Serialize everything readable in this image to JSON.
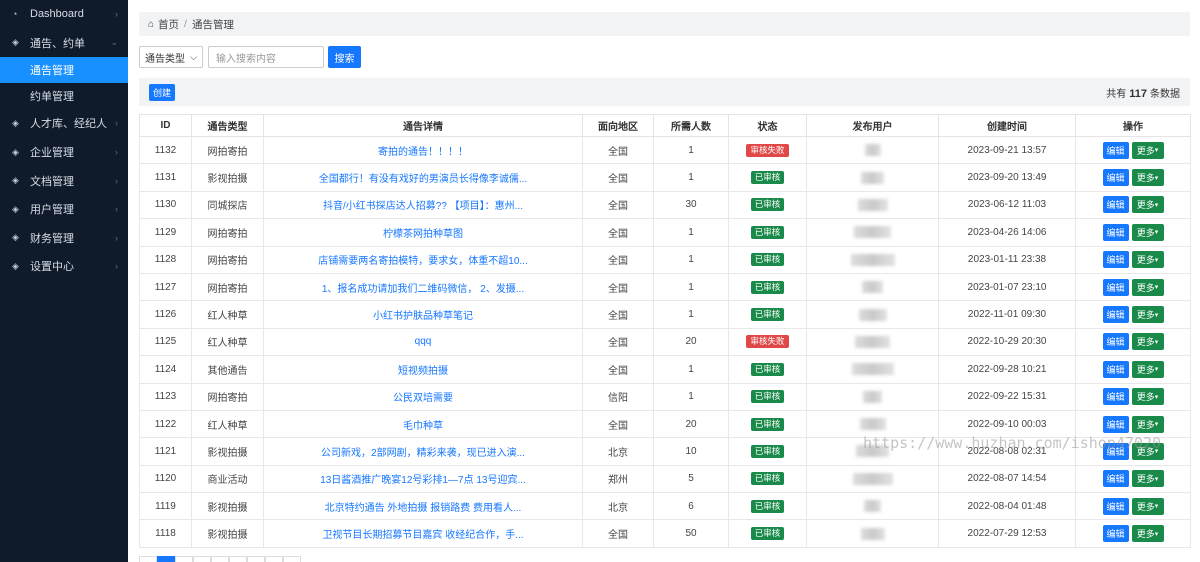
{
  "sidebar": {
    "items": [
      {
        "label": "Dashboard",
        "icon": "dashboard-icon"
      },
      {
        "label": "通告、约单",
        "icon": "chevron-icon",
        "expanded": true,
        "children": [
          {
            "label": "通告管理",
            "active": true
          },
          {
            "label": "约单管理",
            "active": false
          }
        ]
      },
      {
        "label": "人才库、经纪人",
        "icon": "chevron-icon"
      },
      {
        "label": "企业管理",
        "icon": "chevron-icon"
      },
      {
        "label": "文档管理",
        "icon": "chevron-icon"
      },
      {
        "label": "用户管理",
        "icon": "chevron-icon"
      },
      {
        "label": "财务管理",
        "icon": "chevron-icon"
      },
      {
        "label": "设置中心",
        "icon": "chevron-icon"
      }
    ]
  },
  "breadcrumb": {
    "home": "首页",
    "current": "通告管理"
  },
  "search": {
    "type_select": "通告类型",
    "placeholder": "输入搜索内容",
    "button": "搜索"
  },
  "toolbar": {
    "create": "创建",
    "total_prefix": "共有",
    "total_count": "117",
    "total_suffix": "条数据"
  },
  "table": {
    "headers": [
      "ID",
      "通告类型",
      "通告详情",
      "面向地区",
      "所需人数",
      "状态",
      "发布用户",
      "创建时间",
      "操作"
    ],
    "edit_label": "编辑",
    "more_label": "更多",
    "rows": [
      {
        "id": "1132",
        "type": "网拍寄拍",
        "detail": "寄拍的通告！！！！",
        "region": "全国",
        "count": "1",
        "status": "审核失败",
        "status_kind": "fail",
        "created": "2023-09-21 13:57"
      },
      {
        "id": "1131",
        "type": "影视拍摄",
        "detail": "全国都行！有没有戏好的男演员长得像李诚儒...",
        "region": "全国",
        "count": "1",
        "status": "已审核",
        "status_kind": "ok",
        "created": "2023-09-20 13:49"
      },
      {
        "id": "1130",
        "type": "同城探店",
        "detail": "抖音/小红书探店达人招募?? 【项目】：惠州...",
        "region": "全国",
        "count": "30",
        "status": "已审核",
        "status_kind": "ok",
        "created": "2023-06-12 11:03"
      },
      {
        "id": "1129",
        "type": "网拍寄拍",
        "detail": "柠檬茶网拍种草图",
        "region": "全国",
        "count": "1",
        "status": "已审核",
        "status_kind": "ok",
        "created": "2023-04-26 14:06"
      },
      {
        "id": "1128",
        "type": "网拍寄拍",
        "detail": "店铺需要两名寄拍模特，要求女，体重不超10...",
        "region": "全国",
        "count": "1",
        "status": "已审核",
        "status_kind": "ok",
        "created": "2023-01-11 23:38"
      },
      {
        "id": "1127",
        "type": "网拍寄拍",
        "detail": "1、报名成功请加我们二维码微信， 2、发摄...",
        "region": "全国",
        "count": "1",
        "status": "已审核",
        "status_kind": "ok",
        "created": "2023-01-07 23:10"
      },
      {
        "id": "1126",
        "type": "红人种草",
        "detail": "小红书护肤品种草笔记",
        "region": "全国",
        "count": "1",
        "status": "已审核",
        "status_kind": "ok",
        "created": "2022-11-01 09:30"
      },
      {
        "id": "1125",
        "type": "红人种草",
        "detail": "qqq",
        "region": "全国",
        "count": "20",
        "status": "审核失败",
        "status_kind": "fail",
        "created": "2022-10-29 20:30"
      },
      {
        "id": "1124",
        "type": "其他通告",
        "detail": "短视频拍摄",
        "region": "全国",
        "count": "1",
        "status": "已审核",
        "status_kind": "ok",
        "created": "2022-09-28 10:21"
      },
      {
        "id": "1123",
        "type": "网拍寄拍",
        "detail": "公民双培需要",
        "region": "信阳",
        "count": "1",
        "status": "已审核",
        "status_kind": "ok",
        "created": "2022-09-22 15:31"
      },
      {
        "id": "1122",
        "type": "红人种草",
        "detail": "毛巾种草",
        "region": "全国",
        "count": "20",
        "status": "已审核",
        "status_kind": "ok",
        "created": "2022-09-10 00:03"
      },
      {
        "id": "1121",
        "type": "影视拍摄",
        "detail": "公司新戏，2部网剧，精彩来袭，现已进入演...",
        "region": "北京",
        "count": "10",
        "status": "已审核",
        "status_kind": "ok",
        "created": "2022-08-08 02:31"
      },
      {
        "id": "1120",
        "type": "商业活动",
        "detail": "13日酱酒推广晚宴12号彩排1—7点 13号迎宾...",
        "region": "郑州",
        "count": "5",
        "status": "已审核",
        "status_kind": "ok",
        "created": "2022-08-07 14:54"
      },
      {
        "id": "1119",
        "type": "影视拍摄",
        "detail": "北京特约通告 外地拍摄 报销路费 费用看人...",
        "region": "北京",
        "count": "6",
        "status": "已审核",
        "status_kind": "ok",
        "created": "2022-08-04 01:48"
      },
      {
        "id": "1118",
        "type": "影视拍摄",
        "detail": "卫视节目长期招募节目嘉宾 收经纪合作，手...",
        "region": "全国",
        "count": "50",
        "status": "已审核",
        "status_kind": "ok",
        "created": "2022-07-29 12:53"
      }
    ]
  },
  "watermark": "https://www.huzhan.com/ishop47020",
  "colors": {
    "sidebar_bg": "#0f1a2b",
    "primary": "#1677ff",
    "success": "#1a8a4a",
    "danger": "#e04848"
  }
}
